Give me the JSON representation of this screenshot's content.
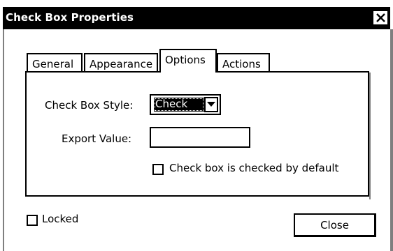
{
  "window": {
    "title": "Check Box Properties"
  },
  "tabs": [
    {
      "label": "General",
      "active": false
    },
    {
      "label": "Appearance",
      "active": false
    },
    {
      "label": "Options",
      "active": true
    },
    {
      "label": "Actions",
      "active": false
    }
  ],
  "options": {
    "style_label": "Check Box Style:",
    "style_value": "Check",
    "export_label": "Export Value:",
    "export_value": "",
    "default_checked_label": "Check box is checked by default",
    "default_checked": false
  },
  "footer": {
    "locked_label": "Locked",
    "locked": false,
    "close_label": "Close"
  },
  "icons": {
    "close": "close-icon",
    "dropdown": "chevron-down-icon"
  },
  "colors": {
    "titlebar_bg": "#000000",
    "titlebar_fg": "#ffffff",
    "frame_shadow": "#7f7f7f"
  }
}
